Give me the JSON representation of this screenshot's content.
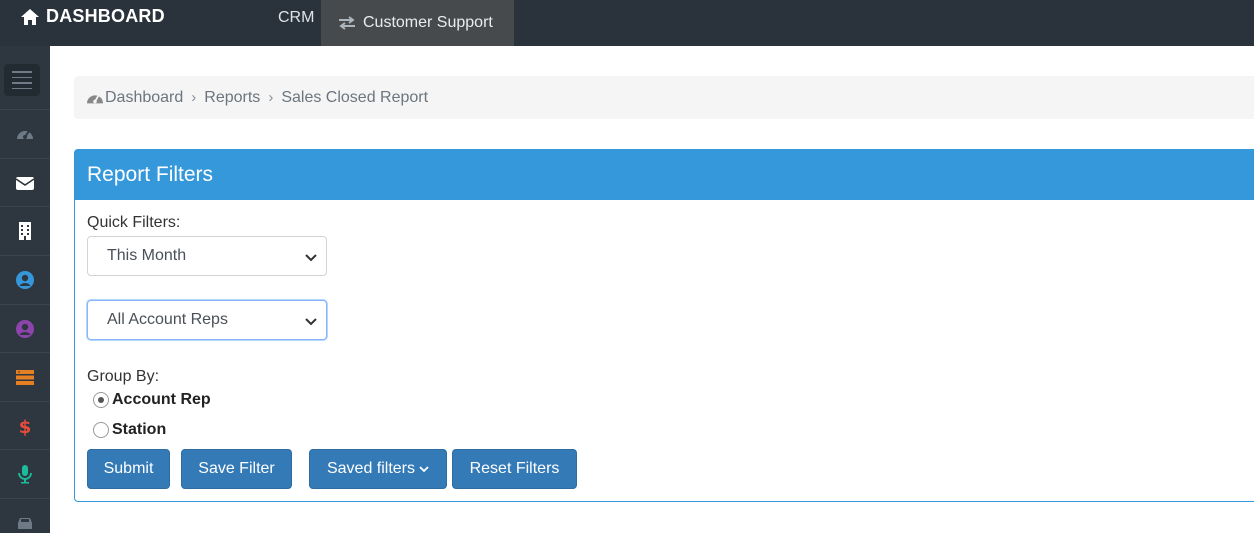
{
  "topbar": {
    "brand": "DASHBOARD",
    "brand_icon": "home-icon",
    "nav_crm": "CRM",
    "nav_customer_support": "Customer Support",
    "nav_customer_support_icon": "exchange-icon",
    "background": "#2a333c"
  },
  "sidebar": {
    "items": [
      {
        "icon": "dashboard-gauge-icon",
        "color": "#6d7a86"
      },
      {
        "icon": "envelope-icon",
        "color": "#ffffff"
      },
      {
        "icon": "building-icon",
        "color": "#ffffff"
      },
      {
        "icon": "user-circle-icon",
        "color": "#3498db"
      },
      {
        "icon": "user-circle-icon",
        "color": "#8e44ad"
      },
      {
        "icon": "server-icon",
        "color": "#e67e22"
      },
      {
        "icon": "dollar-icon",
        "color": "#e74c3c"
      },
      {
        "icon": "microphone-icon",
        "color": "#1abc9c"
      },
      {
        "icon": "car-icon",
        "color": "#6d7a86"
      }
    ]
  },
  "breadcrumb": {
    "items": [
      "Dashboard",
      "Reports",
      "Sales Closed Report"
    ]
  },
  "panel": {
    "title": "Report Filters",
    "accent": "#3498db",
    "quick_filters_label": "Quick Filters:",
    "quick_filter_value": "This Month",
    "account_reps_value": "All Account Reps",
    "group_by_label": "Group By:",
    "group_by_options": [
      {
        "label": "Account Rep",
        "checked": true
      },
      {
        "label": "Station",
        "checked": false
      }
    ]
  },
  "buttons": {
    "submit": "Submit",
    "save_filter": "Save Filter",
    "saved_filters": "Saved filters",
    "reset_filters": "Reset Filters",
    "color": "#337ab7"
  }
}
